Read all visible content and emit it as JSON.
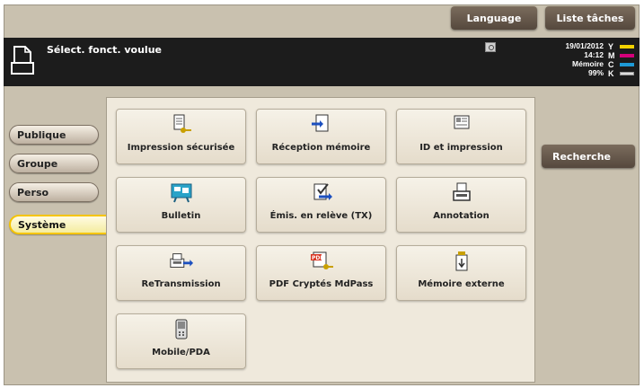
{
  "header": {
    "language_label": "Language",
    "tasks_label": "Liste tâches"
  },
  "status": {
    "message": "Sélect. fonct. voulue",
    "date": "19/01/2012",
    "time": "14:12",
    "memory_label": "Mémoire",
    "memory_value": "99%",
    "toner": [
      {
        "label": "Y",
        "color": "#f2d200"
      },
      {
        "label": "M",
        "color": "#d4007a"
      },
      {
        "label": "C",
        "color": "#1e9ad6"
      },
      {
        "label": "K",
        "color": "#222222"
      }
    ]
  },
  "sidebar": {
    "tabs": [
      {
        "label": "Publique"
      },
      {
        "label": "Groupe"
      },
      {
        "label": "Perso"
      },
      {
        "label": "Système"
      }
    ],
    "active": "Système"
  },
  "functions": [
    {
      "label": "Impression sécurisée",
      "icon": "secure-print-icon"
    },
    {
      "label": "Réception mémoire",
      "icon": "memory-rx-icon"
    },
    {
      "label": "ID et impression",
      "icon": "id-print-icon"
    },
    {
      "label": "Bulletin",
      "icon": "bulletin-icon"
    },
    {
      "label": "Émis. en relève (TX)",
      "icon": "polling-tx-icon"
    },
    {
      "label": "Annotation",
      "icon": "annotation-icon"
    },
    {
      "label": "ReTransmission",
      "icon": "retransmission-icon"
    },
    {
      "label": "PDF Cryptés MdPass",
      "icon": "pdf-encrypted-icon"
    },
    {
      "label": "Mémoire externe",
      "icon": "external-memory-icon"
    },
    {
      "label": "Mobile/PDA",
      "icon": "mobile-pda-icon"
    }
  ],
  "search_label": "Recherche",
  "colors": {
    "accent": "#f5c400",
    "panel": "#c9c1af",
    "button_dark": "#5f5246"
  }
}
